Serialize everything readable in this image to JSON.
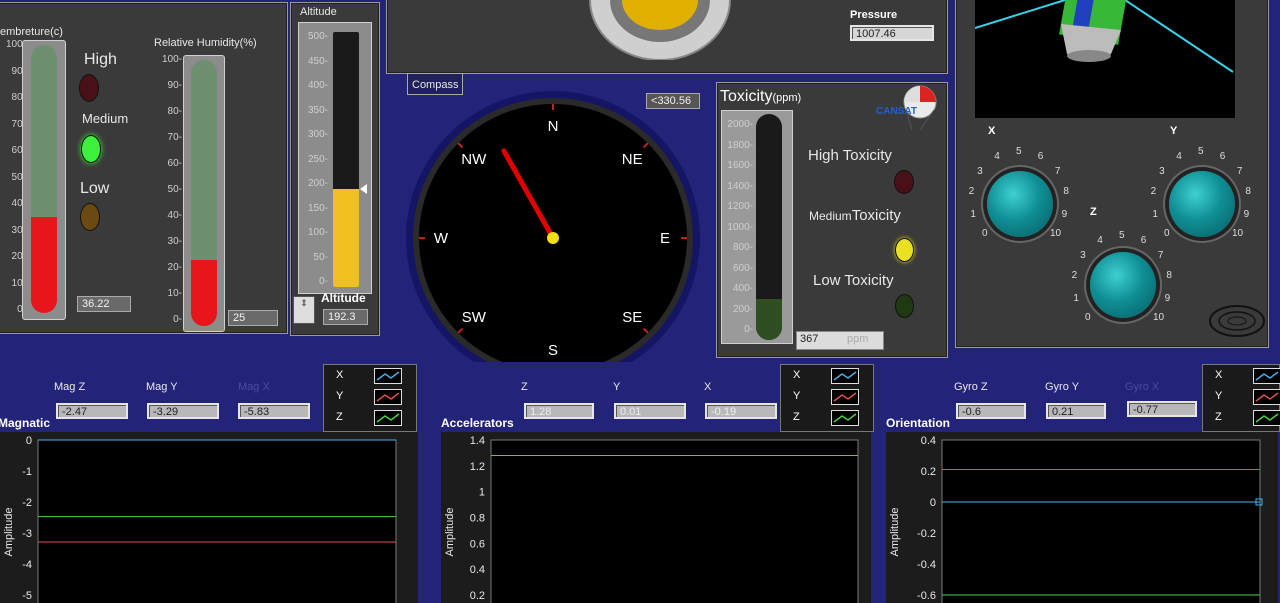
{
  "temperature": {
    "title": "embreture(c)",
    "ticks": [
      "100",
      "90",
      "80",
      "70",
      "60",
      "50",
      "40",
      "30",
      "20",
      "10",
      "0"
    ],
    "value_text": "36.22",
    "level": 0.36
  },
  "levels": {
    "high": "High",
    "medium": "Medium",
    "low": "Low"
  },
  "humidity": {
    "title": "Relative Humidity(%)",
    "ticks": [
      "100",
      "90",
      "80",
      "70",
      "60",
      "50",
      "40",
      "30",
      "20",
      "10",
      "0"
    ],
    "value_text": "25",
    "level": 0.25
  },
  "altitude": {
    "title": "Altitude",
    "ticks": [
      "500",
      "450",
      "400",
      "350",
      "300",
      "250",
      "200",
      "150",
      "100",
      "50",
      "0"
    ],
    "label": "Altitude",
    "value_text": "192.3",
    "level": 0.384
  },
  "pressure": {
    "label": "Pressure",
    "value_text": "1007.46"
  },
  "compass": {
    "tab_label": "Compass",
    "heading_text": "330.56",
    "heading_deg": 330.56,
    "directions": [
      "N",
      "NE",
      "E",
      "SE",
      "S",
      "SW",
      "W",
      "NW"
    ]
  },
  "toxicity": {
    "title": "Toxicity",
    "unit": "(ppm)",
    "ticks": [
      "2000",
      "1800",
      "1600",
      "1400",
      "1200",
      "1000",
      "800",
      "600",
      "400",
      "200",
      "0"
    ],
    "value_text": "367",
    "unit_box": "ppm",
    "level": 0.18,
    "high_label": "High Toxicity",
    "medium_prefix": "Medium",
    "medium_suffix": "Toxicity",
    "low_label": "Low Toxicity",
    "logo_text": "CANSAT"
  },
  "knobs": {
    "x_label": "X",
    "y_label": "Y",
    "z_label": "Z",
    "scale": [
      "0",
      "1",
      "2",
      "3",
      "4",
      "5",
      "6",
      "7",
      "8",
      "9",
      "10"
    ]
  },
  "magnetic": {
    "title": "Magnatic",
    "fields": [
      {
        "label": "Mag Z",
        "value": "-2.47"
      },
      {
        "label": "Mag Y",
        "value": "-3.29"
      },
      {
        "label": "Mag X",
        "value": "-5.83"
      }
    ],
    "legend": [
      "X",
      "Y",
      "Z"
    ]
  },
  "accelerators": {
    "title": "Accelerators",
    "fields": [
      {
        "label": "Z",
        "value": "1.28"
      },
      {
        "label": "Y",
        "value": "0.01"
      },
      {
        "label": "X",
        "value": "-0.19"
      }
    ],
    "legend": [
      "X",
      "Y",
      "Z"
    ]
  },
  "orientation": {
    "title": "Orientation",
    "fields": [
      {
        "label": "Gyro Z",
        "value": "-0.6"
      },
      {
        "label": "Gyro Y",
        "value": "0.21"
      },
      {
        "label": "Gyro X",
        "value": "-0.77"
      }
    ],
    "legend": [
      "X",
      "Y",
      "Z"
    ]
  },
  "colors": {
    "x_series": "#4ab0e8",
    "y_series": "#e05050",
    "z_series": "#4bd24b",
    "thermo_red": "#e8161b",
    "thermo_green": "#6f8f73",
    "gauge_yellow": "#f0c020",
    "background": "#23237a"
  },
  "chart_data": [
    {
      "type": "line",
      "title": "Magnatic",
      "ylabel": "Amplitude",
      "yticks": [
        "0",
        "-1",
        "-2",
        "-3",
        "-4",
        "-5"
      ],
      "ylim": [
        -5,
        0
      ],
      "series": [
        {
          "name": "X",
          "values": [
            0,
            0
          ]
        },
        {
          "name": "Y",
          "values": [
            -3.29,
            -3.29
          ]
        },
        {
          "name": "Z",
          "values": [
            -2.47,
            -2.47
          ]
        }
      ]
    },
    {
      "type": "line",
      "title": "Accelerators",
      "ylabel": "Amplitude",
      "yticks": [
        "1.4",
        "1.2",
        "1",
        "0.8",
        "0.6",
        "0.4",
        "0.2"
      ],
      "ylim": [
        0.15,
        1.4
      ],
      "series": [
        {
          "name": "Z",
          "values": [
            1.28,
            1.28
          ]
        }
      ]
    },
    {
      "type": "line",
      "title": "Orientation",
      "ylabel": "Amplitude",
      "yticks": [
        "0.4",
        "0.2",
        "0",
        "-0.2",
        "-0.4",
        "-0.6"
      ],
      "ylim": [
        -0.6,
        0.4
      ],
      "series": [
        {
          "name": "X",
          "values": [
            0,
            0
          ]
        },
        {
          "name": "Y",
          "values": [
            0.21,
            0.21
          ]
        },
        {
          "name": "Z",
          "values": [
            -0.6,
            -0.6
          ]
        }
      ]
    }
  ]
}
